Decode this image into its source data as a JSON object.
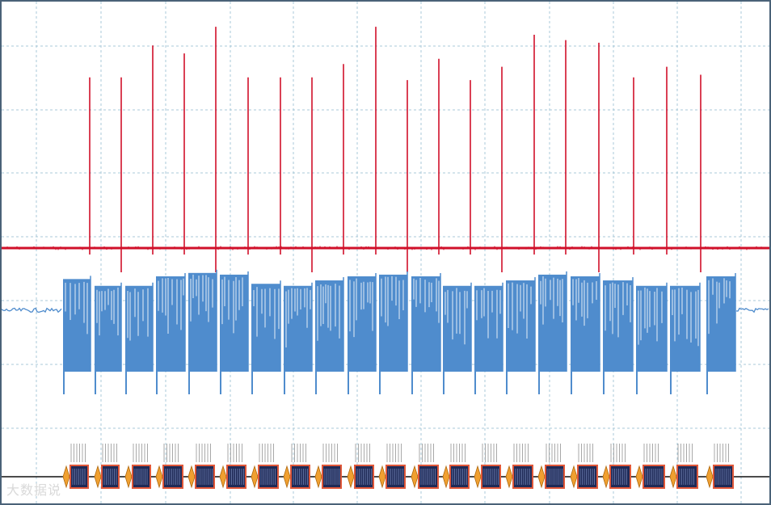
{
  "chart_data": {
    "type": "line",
    "title": "",
    "xlabel": "",
    "ylabel": "",
    "grid": true,
    "colors": {
      "background": "#ffffff",
      "grid": "#a9c9d9",
      "frame": "#4a6278",
      "spike_trace": "#d0102a",
      "burst_trace": "#4f8ccd",
      "decode_box": "#1f2a57",
      "decode_box_border": "#e0583a",
      "decode_marker": "#f0a030",
      "decode_tick": "#a8a8a8"
    },
    "series": [
      {
        "channel": "spikes",
        "baseline": 0,
        "spike_times": [
          111,
          150,
          189,
          228,
          267,
          307,
          347,
          386,
          425,
          465,
          504,
          543,
          582,
          621,
          661,
          700,
          741,
          784,
          825,
          867
        ],
        "spike_heights": [
          0.64,
          0.64,
          0.76,
          0.73,
          0.83,
          0.64,
          0.64,
          0.64,
          0.69,
          0.83,
          0.63,
          0.71,
          0.63,
          0.68,
          0.8,
          0.78,
          0.77,
          0.64,
          0.68,
          0.65
        ]
      },
      {
        "channel": "bursts",
        "baseline": 0,
        "burst_segments": [
          [
            78,
            112,
            0.92
          ],
          [
            117,
            150,
            0.72
          ],
          [
            155,
            189,
            0.72
          ],
          [
            193,
            229,
            1.0
          ],
          [
            233,
            268,
            1.1
          ],
          [
            272,
            307,
            1.05
          ],
          [
            311,
            347,
            0.78
          ],
          [
            351,
            386,
            0.72
          ],
          [
            390,
            425,
            0.88
          ],
          [
            430,
            465,
            1.0
          ],
          [
            469,
            504,
            1.05
          ],
          [
            509,
            545,
            1.0
          ],
          [
            548,
            583,
            0.72
          ],
          [
            587,
            622,
            0.72
          ],
          [
            626,
            662,
            0.88
          ],
          [
            666,
            701,
            1.05
          ],
          [
            706,
            742,
            1.0
          ],
          [
            746,
            783,
            0.88
          ],
          [
            787,
            825,
            0.72
          ],
          [
            829,
            866,
            0.72
          ],
          [
            874,
            910,
            1.0
          ]
        ]
      }
    ],
    "decode_frames": 21
  },
  "watermark": "大数据说"
}
